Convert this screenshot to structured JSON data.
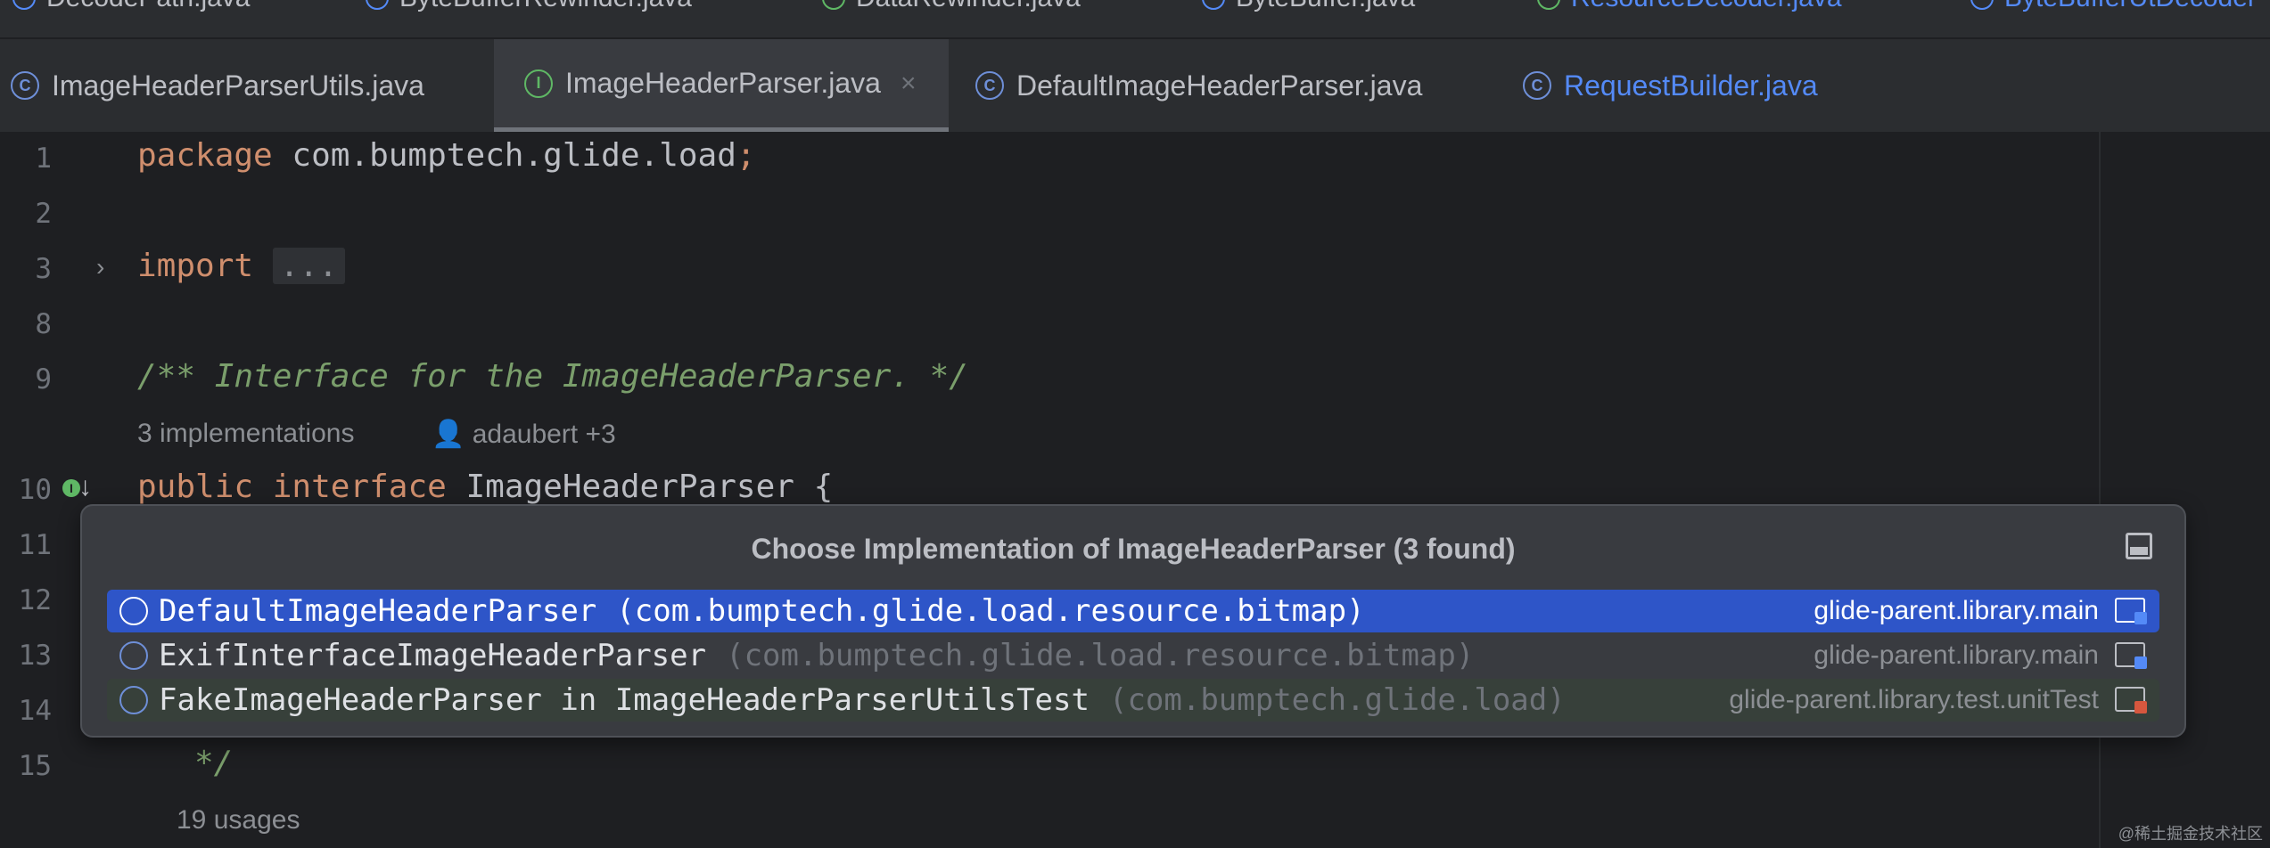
{
  "top_tabs": [
    {
      "label": "DecodePath.java",
      "icon": "class-icon",
      "link": false
    },
    {
      "label": "ByteBufferRewinder.java",
      "icon": "class-icon",
      "link": false
    },
    {
      "label": "DataRewinder.java",
      "icon": "interface-icon",
      "link": false
    },
    {
      "label": "ByteBuffer.java",
      "icon": "class-icon",
      "link": false
    },
    {
      "label": "ResourceDecoder.java",
      "icon": "interface-icon",
      "link": true
    },
    {
      "label": "ByteBufferUtDecoder",
      "icon": "class-icon",
      "link": true
    }
  ],
  "tabs": [
    {
      "label": "ImageHeaderParserUtils.java",
      "icon": "C"
    },
    {
      "label": "ImageHeaderParser.java",
      "icon": "I",
      "active": true,
      "close": "×"
    },
    {
      "label": "DefaultImageHeaderParser.java",
      "icon": "C"
    },
    {
      "label": "RequestBuilder.java",
      "icon": "C",
      "link": true
    }
  ],
  "editor": {
    "lines": [
      "1",
      "2",
      "3",
      "8",
      "9",
      "10",
      "11",
      "12",
      "13",
      "14",
      "15"
    ],
    "code": {
      "line1_kw": "package",
      "line1_rest": " com.bumptech.glide.load",
      "line1_semi": ";",
      "line3_kw": "import",
      "line3_fold": "...",
      "line9_comment": "/** Interface for the ImageHeaderParser. */",
      "line10_kw1": "public",
      "line10_kw2": "interface",
      "line10_rest": " ImageHeaderParser {",
      "line15": "*/"
    },
    "hints": {
      "implementations": "3 implementations",
      "author": "adaubert +3",
      "usages": "19 usages"
    },
    "gutter_impl_marker": "I"
  },
  "popup": {
    "title": "Choose Implementation of ImageHeaderParser (3 found)",
    "items": [
      {
        "name": "DefaultImageHeaderParser",
        "package": "(com.bumptech.glide.load.resource.bitmap)",
        "module": "glide-parent.library.main"
      },
      {
        "name": "ExifInterfaceImageHeaderParser",
        "package": "(com.bumptech.glide.load.resource.bitmap)",
        "module": "glide-parent.library.main"
      },
      {
        "name": "FakeImageHeaderParser in ImageHeaderParserUtilsTest",
        "package": "(com.bumptech.glide.load)",
        "module": "glide-parent.library.test.unitTest"
      }
    ]
  },
  "watermark": "@稀土掘金技术社区",
  "colors": {
    "accent": "#2e55c8",
    "keyword": "#cf8e6d",
    "comment": "#7a9e6b",
    "background": "#1e1f22"
  }
}
